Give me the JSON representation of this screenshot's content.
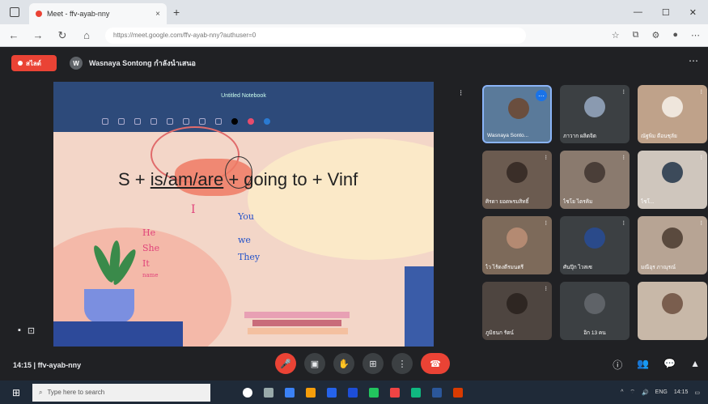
{
  "browser": {
    "tab_title": "Meet - ffv-ayab-nny",
    "url": "https://meet.google.com/ffv-ayab-nny?authuser=0"
  },
  "meet": {
    "present_label": "สไลด์",
    "presenter_name": "Wasnaya Sontong กำลังนำเสนอ",
    "meeting_time": "14:15",
    "meeting_code": "ffv-ayab-nny"
  },
  "slide": {
    "doc_title": "Untitled Notebook",
    "formula_s": "S + ",
    "formula_be": "is/am/are",
    "formula_rest": " + going to + Vinf",
    "notes_left": [
      "He",
      "She",
      "It",
      "name"
    ],
    "notes_i": "I",
    "notes_right": [
      "You",
      "we",
      "They"
    ]
  },
  "participants": [
    {
      "name": "Wasnaya Sonto...",
      "active": true
    },
    {
      "name": "ภาวาก ผลิตจิต",
      "active": false
    },
    {
      "name": "ณัฐพิม ดีอนชุลัย",
      "active": false
    },
    {
      "name": "ศิรดา ยอดพรมสิทธิ์",
      "active": false
    },
    {
      "name": "ไชโย ไตรคิม",
      "active": false
    },
    {
      "name": "ไชโ...",
      "active": false
    },
    {
      "name": "ไว ไร้ดงตีรมนตรี",
      "active": false
    },
    {
      "name": "ศันปุ๊ก ไวสเซ",
      "active": false
    },
    {
      "name": "มณีอุร ภาณุรณ์",
      "active": false
    },
    {
      "name": "ภูมิธนก รัตน์",
      "active": false
    },
    {
      "name": "อิก 13 คน",
      "active": false
    },
    {
      "name": "",
      "active": false
    }
  ],
  "taskbar": {
    "search_placeholder": "Type here to search",
    "time": "14:15",
    "language": "ENG"
  }
}
